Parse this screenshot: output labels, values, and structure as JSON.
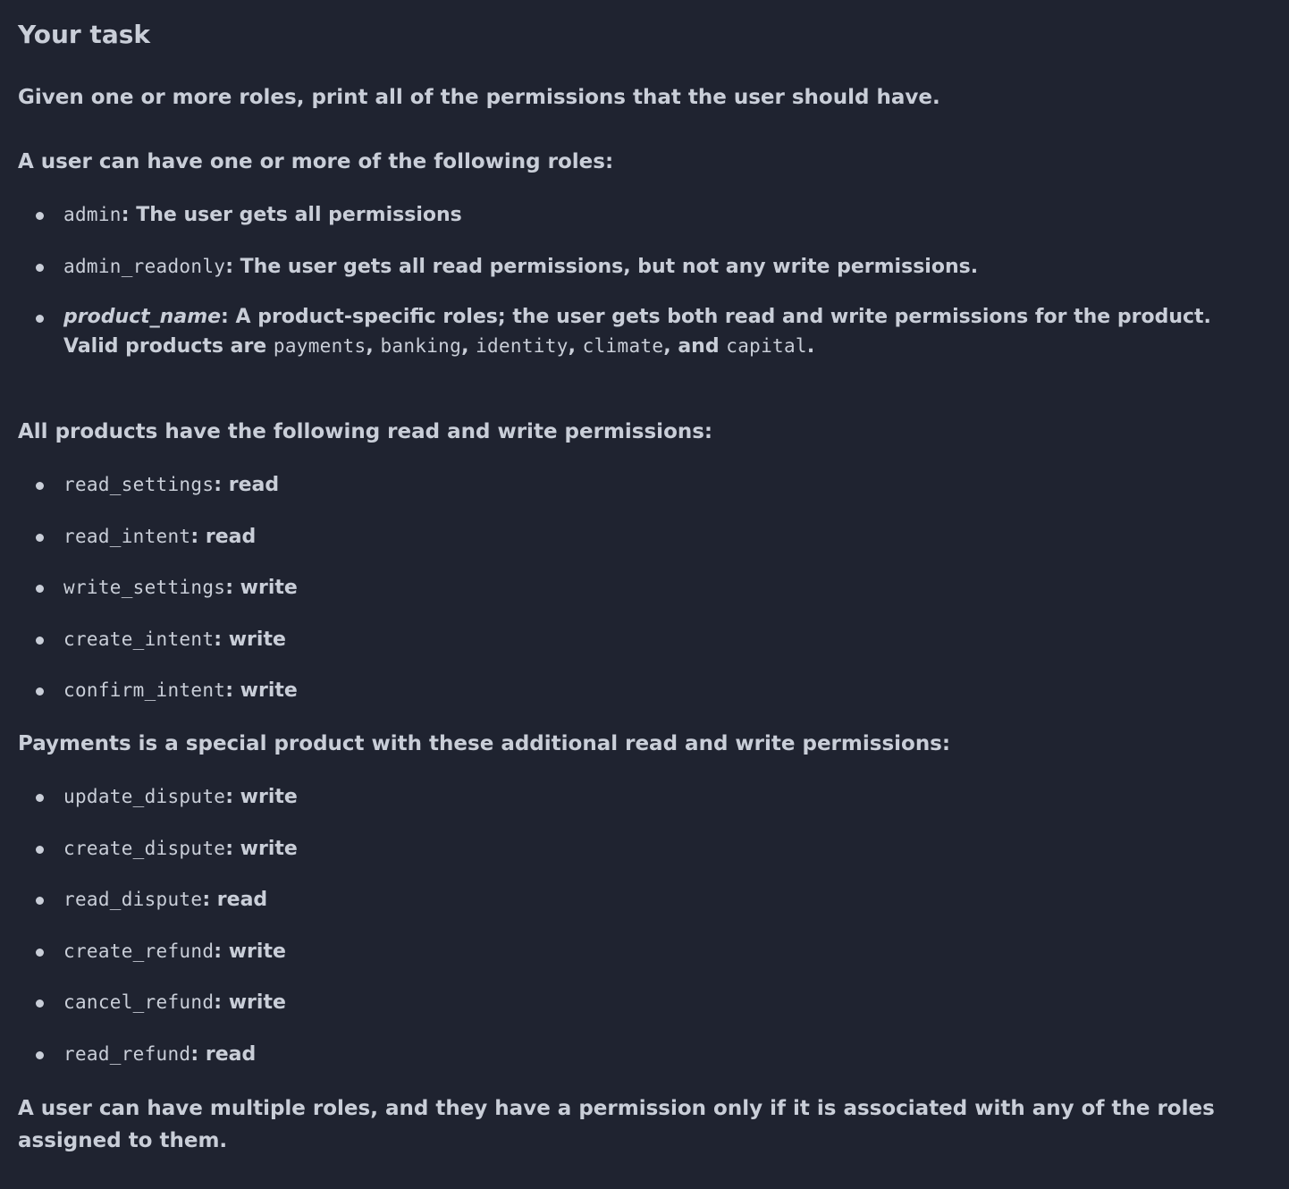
{
  "title": "Your task",
  "intro": "Given one or more roles, print all of the permissions that the user should have.",
  "roles_heading": "A user can have one or more of the following roles:",
  "roles": [
    {
      "code": "admin",
      "sep": ":",
      "desc": " The user gets all permissions"
    },
    {
      "code": "admin_readonly",
      "sep": ":",
      "desc": " The user gets all read permissions, but not any write permissions."
    },
    {
      "name": "product_name",
      "sep": ":",
      "desc": " A product-specific roles; the user gets both read and write permissions for the product. Valid products are ",
      "products": [
        "payments",
        "banking",
        "identity",
        "climate",
        "capital"
      ],
      "and": "and",
      "end": "."
    }
  ],
  "products_heading": "All products have the following read and write permissions:",
  "product_permissions": [
    {
      "code": "read_settings",
      "type": "read"
    },
    {
      "code": "read_intent",
      "type": "read"
    },
    {
      "code": "write_settings",
      "type": "write"
    },
    {
      "code": "create_intent",
      "type": "write"
    },
    {
      "code": "confirm_intent",
      "type": "write"
    }
  ],
  "payments_heading": "Payments is a special product with these additional read and write permissions:",
  "payments_permissions": [
    {
      "code": "update_dispute",
      "type": "write"
    },
    {
      "code": "create_dispute",
      "type": "write"
    },
    {
      "code": "read_dispute",
      "type": "read"
    },
    {
      "code": "create_refund",
      "type": "write"
    },
    {
      "code": "cancel_refund",
      "type": "write"
    },
    {
      "code": "read_refund",
      "type": "read"
    }
  ],
  "footer": "A user can have multiple roles, and they have a permission only if it is associated with any of the roles assigned to them."
}
